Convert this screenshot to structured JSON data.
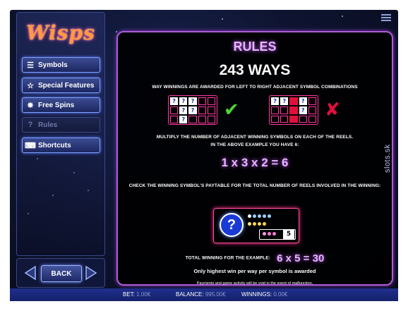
{
  "app": {
    "logo_text": "Wisps"
  },
  "watermark": "slots.sk",
  "nav": {
    "items": [
      {
        "label": "Symbols",
        "icon": "list-icon",
        "state": "normal"
      },
      {
        "label": "Special Features",
        "icon": "star-icon",
        "state": "normal"
      },
      {
        "label": "Free Spins",
        "icon": "burst-icon",
        "state": "normal"
      },
      {
        "label": "Rules",
        "icon": "question-icon",
        "state": "active"
      },
      {
        "label": "Shortcuts",
        "icon": "keyboard-icon",
        "state": "normal"
      }
    ],
    "back_label": "BACK"
  },
  "rules": {
    "title": "RULES",
    "ways": "243 WAYS",
    "line1": "WAY WINNINGS ARE AWARDED FOR LEFT TO RIGHT ADJACENT SYMBOL COMBINATIONS",
    "line2a": "MULTIPLY THE NUMBER OF ADJACENT WINNING SYMBOLS ON EACH OF THE REELS.",
    "line2b": "IN THE ABOVE EXAMPLE YOU HAVE 6:",
    "equation": "1 x 3 x 2 = 6",
    "line3": "CHECK THE WINNING SYMBOL'S PAYTABLE FOR THE TOTAL NUMBER OF REELS INVOLVED IN THE WINNING:",
    "paytable_value": "5",
    "total_label": "TOTAL WINNING FOR THE EXAMPLE:",
    "total_value": "6 x 5 = 30",
    "note1": "Only highest win per way per symbol is awarded",
    "note2": "Payments and game activity will be void in the event of malfunction.",
    "cell_symbol": "?",
    "valid_mark": "✔",
    "invalid_mark": "✘"
  },
  "footer": {
    "bet_label": "BET:",
    "bet_value": "1.00€",
    "balance_label": "BALANCE:",
    "balance_value": "995.00€",
    "winnings_label": "WINNINGS:",
    "winnings_value": "0.00€"
  },
  "colors": {
    "accent_purple": "#c65bff",
    "grid_pink": "#ff3aa0",
    "check_green": "#4cd636",
    "cross_red": "#e0103c"
  }
}
